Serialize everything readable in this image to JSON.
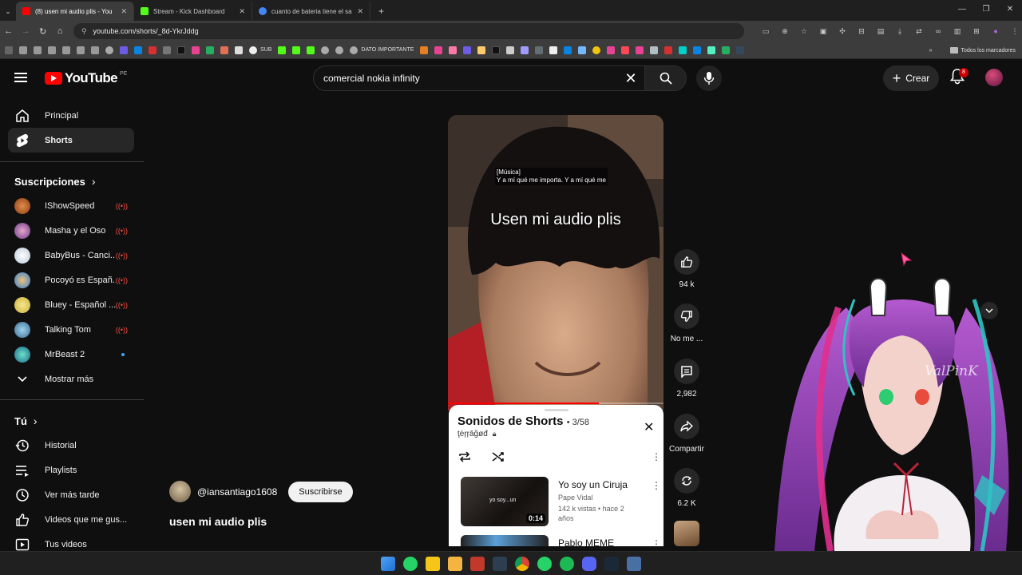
{
  "browser": {
    "tabs": [
      {
        "title": "(8) usen mi audio plis - You",
        "favicon_color": "#ff0000",
        "active": true
      },
      {
        "title": "Stream - Kick Dashboard",
        "favicon_color": "#53fc18",
        "active": false
      },
      {
        "title": "cuanto de bateria tiene el sam",
        "favicon_color": "#4285f4",
        "active": false
      }
    ],
    "url": "youtube.com/shorts/_8d-YkrJddg",
    "bookmarks": [
      "SUB",
      "DATO IMPORTANTE"
    ],
    "bookmarks_all": "Todos los marcadores"
  },
  "header": {
    "logo_text": "YouTube",
    "country_code": "PE",
    "search_query": "comercial nokia infinity",
    "create_label": "Crear",
    "notification_count": "8"
  },
  "sidebar": {
    "main_items": [
      {
        "label": "Principal",
        "icon": "home-icon"
      },
      {
        "label": "Shorts",
        "icon": "shorts-icon",
        "active": true
      }
    ],
    "subscriptions_heading": "Suscripciones",
    "subscriptions": [
      {
        "label": "IShowSpeed",
        "status": "live",
        "color": "#c0392b"
      },
      {
        "label": "Masha y el Oso",
        "status": "live",
        "color": "#8e44ad"
      },
      {
        "label": "BabyBus - Canci...",
        "status": "live",
        "color": "#e8e8e8"
      },
      {
        "label": "Pocoyó ᴇs Españ...",
        "status": "live",
        "color": "#3498db"
      },
      {
        "label": "Bluey - Español ...",
        "status": "live",
        "color": "#f1c40f"
      },
      {
        "label": "Talking Tom",
        "status": "live",
        "color": "#2980b9"
      },
      {
        "label": "MrBeast 2",
        "status": "new",
        "color": "#1abc9c"
      }
    ],
    "show_more": "Mostrar más",
    "you_heading": "Tú",
    "you_items": [
      {
        "label": "Historial",
        "icon": "history-icon"
      },
      {
        "label": "Playlists",
        "icon": "playlists-icon"
      },
      {
        "label": "Ver más tarde",
        "icon": "clock-icon"
      },
      {
        "label": "Videos que me gus...",
        "icon": "thumbs-up-icon"
      },
      {
        "label": "Tus videos",
        "icon": "your-videos-icon"
      }
    ]
  },
  "player": {
    "caption_line1": "[Música]",
    "caption_line2": "Y a mí qué me importa. Y a mí qué me",
    "overlay_title": "Usen mi audio plis",
    "progress": 0.7
  },
  "actions": {
    "likes": "94 k",
    "dislike_label": "No me ...",
    "comments": "2,982",
    "share_label": "Compartir",
    "remix": "6.2 K"
  },
  "playlist": {
    "title": "Sonidos de Shorts",
    "position": "• 3/58",
    "owner": "ţėŗŗāğøđ",
    "items": [
      {
        "title": "Yo soy un Ciruja",
        "channel": "Pape Vidal",
        "meta": "142 k vistas • hace 2 años",
        "duration": "0:14",
        "thumb_text": "yo soy...un"
      },
      {
        "title": "Pablo MEME"
      }
    ]
  },
  "channel": {
    "handle": "@iansantiago1608",
    "subscribe_label": "Suscribirse",
    "video_title": "usen mi audio plis"
  },
  "overlay_watermark": "ValPinK"
}
